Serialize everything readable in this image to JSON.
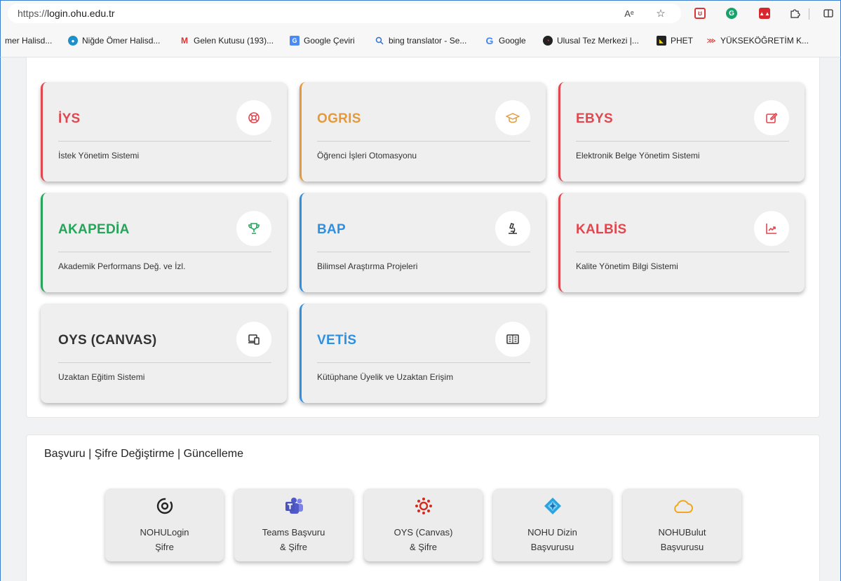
{
  "browser": {
    "url_scheme": "https://",
    "url_host": "login.ohu.edu.tr",
    "read_aloud_label": "Aᵉ",
    "bookmarks": [
      {
        "label": "mer Halisd..."
      },
      {
        "label": "Niğde Ömer Halisd..."
      },
      {
        "label": "Gelen Kutusu (193)..."
      },
      {
        "label": "Google Çeviri"
      },
      {
        "label": "bing translator - Se..."
      },
      {
        "label": "Google"
      },
      {
        "label": "Ulusal Tez Merkezi |..."
      },
      {
        "label": "PHET"
      },
      {
        "label": "YÜKSEKÖĞRETİM K..."
      }
    ]
  },
  "systems": [
    {
      "title": "İYS",
      "subtitle": "İstek Yönetim Sistemi",
      "color": "#e0474f",
      "icon": "lifebuoy-icon"
    },
    {
      "title": "OGRIS",
      "subtitle": "Öğrenci İşleri Otomasyonu",
      "color": "#e49a3c",
      "icon": "graduation-cap-icon"
    },
    {
      "title": "EBYS",
      "subtitle": "Elektronik Belge Yönetim Sistemi",
      "color": "#e0474f",
      "icon": "edit-icon"
    },
    {
      "title": "AKAPEDİA",
      "subtitle": "Akademik Performans Değ. ve İzl.",
      "color": "#27a35a",
      "icon": "trophy-icon"
    },
    {
      "title": "BAP",
      "subtitle": "Bilimsel Araştırma Projeleri",
      "color": "#2f8fe0",
      "icon": "microscope-icon"
    },
    {
      "title": "KALBİS",
      "subtitle": "Kalite Yönetim Bilgi Sistemi",
      "color": "#e0474f",
      "icon": "chart-line-icon"
    },
    {
      "title": "OYS (CANVAS)",
      "subtitle": "Uzaktan Eğitim Sistemi",
      "color": "#333333",
      "icon": "devices-icon"
    },
    {
      "title": "VETİS",
      "subtitle": "Kütüphane Üyelik ve Uzaktan Erişim",
      "color": "#2f8fe0",
      "icon": "book-icon"
    }
  ],
  "applications": {
    "title": "Başvuru | Şifre Değiştirme | Güncelleme",
    "tiles": [
      {
        "line1": "NOHULogin",
        "line2": "Şifre",
        "icon": "nohulogin-icon"
      },
      {
        "line1": "Teams Başvuru",
        "line2": "& Şifre",
        "icon": "teams-icon"
      },
      {
        "line1": "OYS (Canvas)",
        "line2": "& Şifre",
        "icon": "canvas-icon"
      },
      {
        "line1": "NOHU Dizin",
        "line2": "Başvurusu",
        "icon": "directory-icon"
      },
      {
        "line1": "NOHUBulut",
        "line2": "Başvurusu",
        "icon": "cloud-icon"
      }
    ]
  }
}
